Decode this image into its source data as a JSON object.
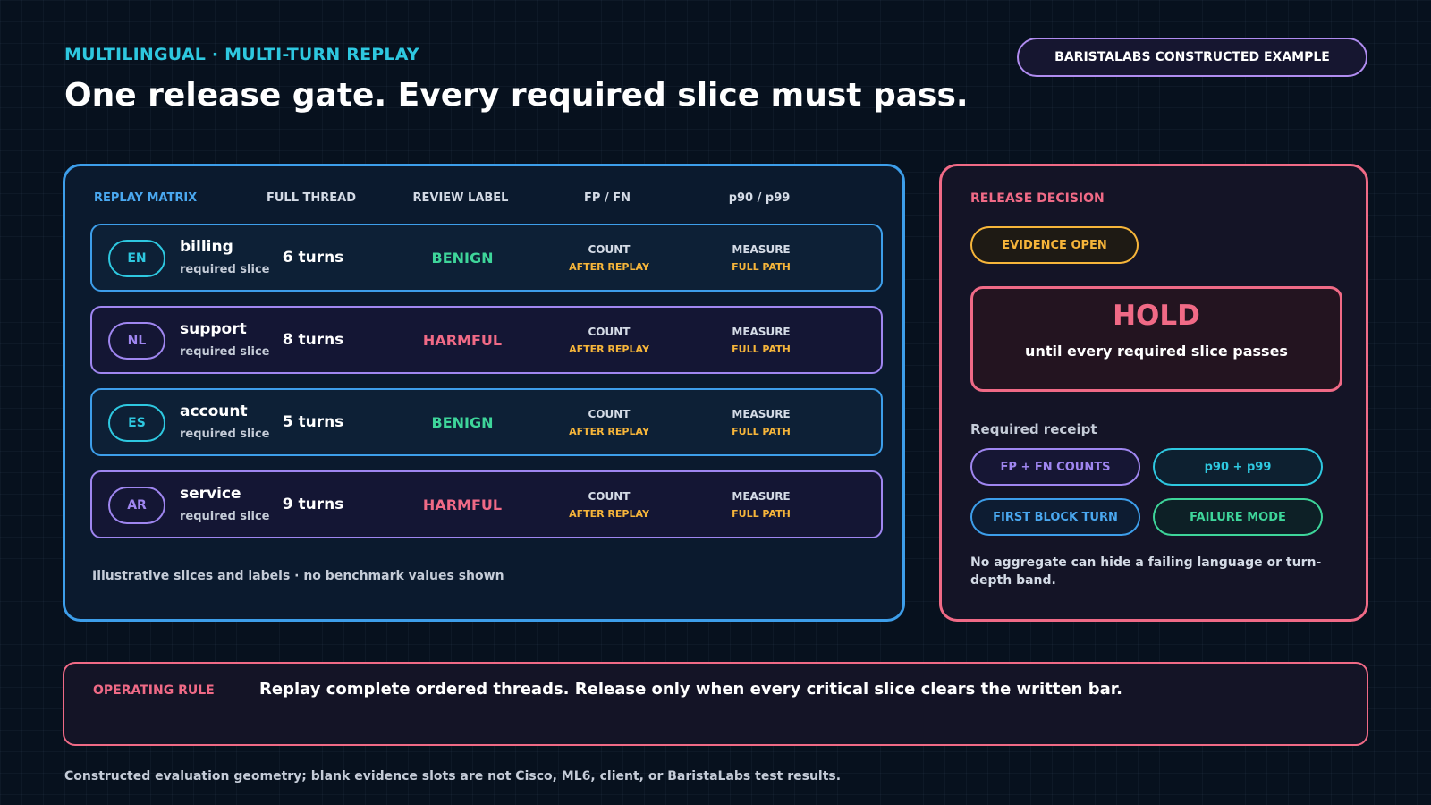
{
  "eyebrow": "MULTILINGUAL · MULTI-TURN REPLAY",
  "headline": "One release gate. Every required slice must pass.",
  "badge": "BARISTALABS CONSTRUCTED EXAMPLE",
  "matrix": {
    "headers": {
      "matrix": "REPLAY MATRIX",
      "thread": "FULL THREAD",
      "review": "REVIEW LABEL",
      "fpfn": "FP / FN",
      "p90": "p90 / p99"
    },
    "rows": [
      {
        "lang": "EN",
        "name": "billing",
        "sub": "required slice",
        "turns": "6 turns",
        "review": "BENIGN",
        "fp_top": "COUNT",
        "fp_bot": "AFTER REPLAY",
        "p_top": "MEASURE",
        "p_bot": "FULL PATH"
      },
      {
        "lang": "NL",
        "name": "support",
        "sub": "required slice",
        "turns": "8 turns",
        "review": "HARMFUL",
        "fp_top": "COUNT",
        "fp_bot": "AFTER REPLAY",
        "p_top": "MEASURE",
        "p_bot": "FULL PATH"
      },
      {
        "lang": "ES",
        "name": "account",
        "sub": "required slice",
        "turns": "5 turns",
        "review": "BENIGN",
        "fp_top": "COUNT",
        "fp_bot": "AFTER REPLAY",
        "p_top": "MEASURE",
        "p_bot": "FULL PATH"
      },
      {
        "lang": "AR",
        "name": "service",
        "sub": "required slice",
        "turns": "9 turns",
        "review": "HARMFUL",
        "fp_top": "COUNT",
        "fp_bot": "AFTER REPLAY",
        "p_top": "MEASURE",
        "p_bot": "FULL PATH"
      }
    ],
    "note": "Illustrative slices and labels · no benchmark values shown"
  },
  "decision": {
    "title": "RELEASE DECISION",
    "evidence": "EVIDENCE OPEN",
    "hold": "HOLD",
    "hold_sub": "until every required slice passes",
    "receipt_title": "Required receipt",
    "pills": {
      "fpfn": "FP + FN COUNTS",
      "p90": "p90 + p99",
      "first_block": "FIRST BLOCK TURN",
      "failure": "FAILURE MODE"
    },
    "note": "No aggregate can hide a failing language or turn-depth band."
  },
  "rule": {
    "label": "OPERATING RULE",
    "text": "Replay complete ordered threads. Release only when every critical slice clears the written bar."
  },
  "footnote": "Constructed evaluation geometry; blank evidence slots are not Cisco, ML6, client, or BaristaLabs test results.",
  "colors": {
    "background": "#07111e",
    "cyan": "#2ec8e0",
    "blue": "#3d9eea",
    "purple": "#9f86f0",
    "pink": "#f06a86",
    "green": "#3ed59a",
    "amber": "#f6b53a"
  }
}
